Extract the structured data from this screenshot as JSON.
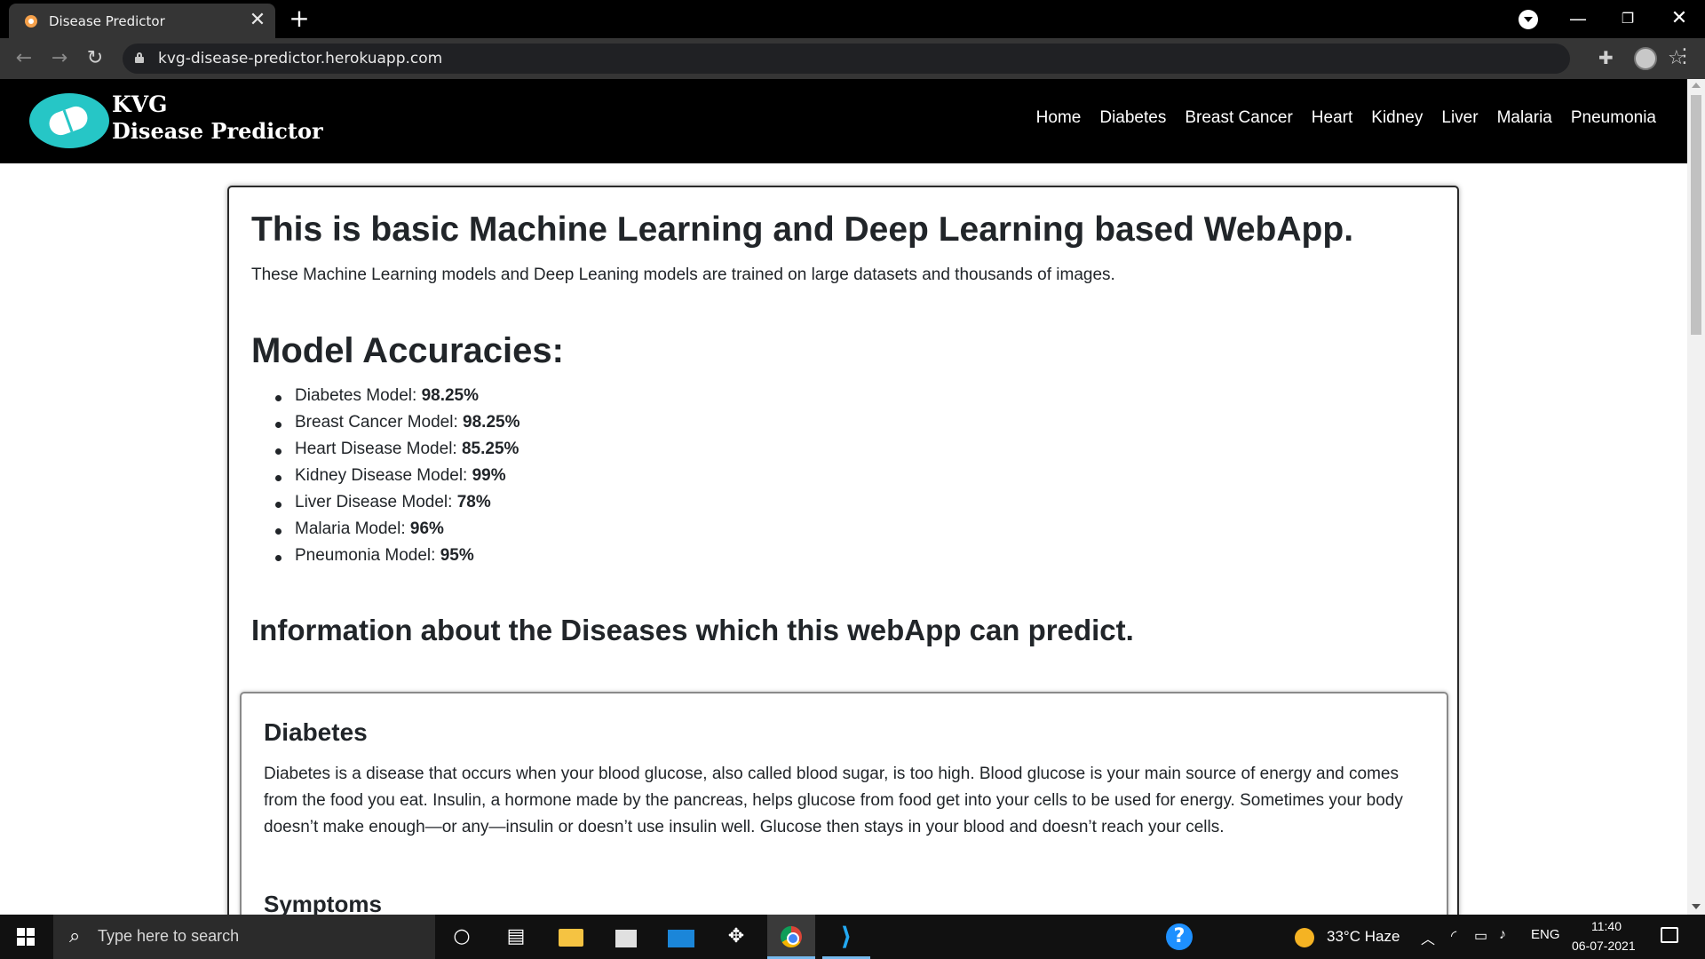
{
  "browser": {
    "tab_title": "Disease Predictor",
    "tab_close": "✕",
    "new_tab": "+",
    "url": "kvg-disease-predictor.herokuapp.com",
    "window_controls": {
      "minimize": "—",
      "restore": "❐",
      "close": "✕"
    }
  },
  "site": {
    "logo_line1": "KVG",
    "logo_line2": "Disease Predictor",
    "nav": [
      "Home",
      "Diabetes",
      "Breast Cancer",
      "Heart",
      "Kidney",
      "Liver",
      "Malaria",
      "Pneumonia"
    ]
  },
  "main": {
    "title": "This is basic Machine Learning and Deep Learning based WebApp.",
    "subtitle": "These Machine Learning models and Deep Leaning models are trained on large datasets and thousands of images.",
    "accuracies_heading": "Model Accuracies:",
    "accuracies": [
      {
        "label": "Diabetes Model: ",
        "value": "98.25%"
      },
      {
        "label": "Breast Cancer Model: ",
        "value": "98.25%"
      },
      {
        "label": "Heart Disease Model: ",
        "value": "85.25%"
      },
      {
        "label": "Kidney Disease Model: ",
        "value": "99%"
      },
      {
        "label": "Liver Disease Model: ",
        "value": "78%"
      },
      {
        "label": "Malaria Model: ",
        "value": "96%"
      },
      {
        "label": "Pneumonia Model: ",
        "value": "95%"
      }
    ],
    "info_heading": "Information about the Diseases which this webApp can predict.",
    "disease": {
      "title": "Diabetes",
      "description": "Diabetes is a disease that occurs when your blood glucose, also called blood sugar, is too high. Blood glucose is your main source of energy and comes from the food you eat. Insulin, a hormone made by the pancreas, helps glucose from food get into your cells to be used for energy. Sometimes your body doesn’t make enough—or any—insulin or doesn’t use insulin well. Glucose then stays in your blood and doesn’t reach your cells.",
      "symptoms_heading": "Symptoms"
    }
  },
  "taskbar": {
    "search_placeholder": "Type here to search",
    "weather": "33°C  Haze",
    "language": "ENG",
    "time": "11:40",
    "date": "06-07-2021"
  },
  "icons": {
    "back": "back-arrow-icon",
    "forward": "forward-arrow-icon",
    "reload": "reload-icon",
    "lock": "lock-icon",
    "star": "star-icon",
    "extensions": "puzzle-icon",
    "menu": "kebab-menu-icon"
  },
  "colors": {
    "logo_teal": "#26c6c6",
    "site_nav_bg": "#000000",
    "text": "#212529"
  }
}
